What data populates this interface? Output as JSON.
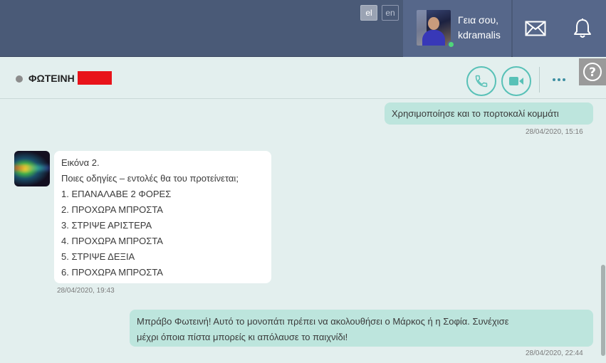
{
  "topbar": {
    "languages": [
      {
        "label": "el",
        "active": true
      },
      {
        "label": "en",
        "active": false
      }
    ],
    "user": {
      "greeting": "Γεια σου,",
      "username": "kdramalis",
      "online": true
    },
    "icons": {
      "mail": "mail-icon",
      "notifications": "bell-icon"
    }
  },
  "chat": {
    "contact": {
      "name": "ΦΩΤΕΙΝΗ",
      "status_color": "#8c8c8c"
    },
    "actions": {
      "call": "phone-icon",
      "video": "video-icon",
      "more": "more-options-icon",
      "help": "?"
    },
    "messages": [
      {
        "direction": "outgoing",
        "lines": [
          "Χρησιμοποίησε και το πορτοκαλί κομμάτι"
        ],
        "timestamp": "28/04/2020, 15:16"
      },
      {
        "direction": "incoming",
        "lines": [
          "Εικόνα 2.",
          "Ποιες οδηγίες – εντολές θα του προτείνεται;",
          "1. ΕΠΑΝΑΛΑΒΕ 2 ΦΟΡΕΣ",
          "2. ΠΡΟΧΩΡΑ ΜΠΡΟΣΤΑ",
          "3. ΣΤΡΙΨΕ ΑΡΙΣΤΕΡΑ",
          "4. ΠΡΟΧΩΡΑ ΜΠΡΟΣΤΑ",
          "5. ΣΤΡΙΨΕ ΔΕΞΙΑ",
          "6. ΠΡΟΧΩΡΑ ΜΠΡΟΣΤΑ"
        ],
        "timestamp": "28/04/2020, 19:43"
      },
      {
        "direction": "outgoing",
        "lines": [
          "Μπράβο Φωτεινή! Αυτό το μονοπάτι πρέπει να ακολουθήσει ο Μάρκος ή η Σοφία. Συνέχισε",
          "μέχρι όποια πίστα μπορείς κι απόλαυσε το παιχνίδι!"
        ],
        "timestamp": "28/04/2020, 22:44"
      }
    ]
  },
  "colors": {
    "topbar_bg": "#4a5a77",
    "chat_bg": "#e3efee",
    "outgoing_bubble": "#bde5dd",
    "incoming_bubble": "#ffffff",
    "accent": "#58c1b7",
    "online": "#4fd67a",
    "redaction": "#e8131a"
  }
}
